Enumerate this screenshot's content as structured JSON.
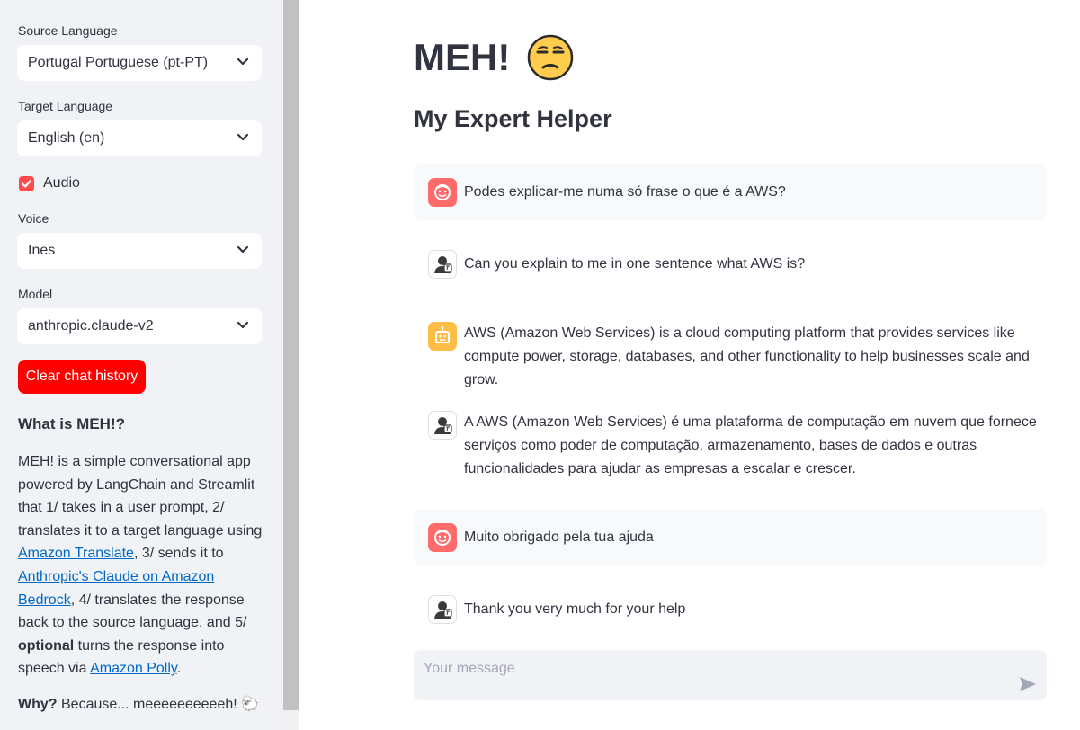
{
  "sidebar": {
    "source_language": {
      "label": "Source Language",
      "value": "Portugal Portuguese (pt-PT)"
    },
    "target_language": {
      "label": "Target Language",
      "value": "English (en)"
    },
    "audio": {
      "label": "Audio",
      "checked": true
    },
    "voice": {
      "label": "Voice",
      "value": "Ines"
    },
    "model": {
      "label": "Model",
      "value": "anthropic.claude-v2"
    },
    "clear_button": "Clear chat history",
    "about": {
      "title": "What is MEH!?",
      "p1": "MEH! is a simple conversational app powered by LangChain and Streamlit that 1/ takes in a user prompt, 2/ translates it to a target language using ",
      "link1": "Amazon Translate",
      "p2": ", 3/ sends it to ",
      "link2": "Anthropic's Claude on Amazon Bedrock",
      "p3": ", 4/ translates the response back to the source language, and 5/ ",
      "bold": "optional",
      "p4": " turns the response into speech via ",
      "link3": "Amazon Polly",
      "p5": "."
    },
    "why": {
      "bold": "Why?",
      "text": " Because... meeeeeeeeeeh! 🐑"
    }
  },
  "main": {
    "title": "MEH!",
    "title_icon": "unamused-face-icon",
    "subtitle": "My Expert Helper",
    "messages": [
      {
        "role": "user",
        "text": "Podes explicar-me numa só frase o que é a AWS?"
      },
      {
        "role": "translation",
        "text": "Can you explain to me in one sentence what AWS is?"
      },
      {
        "role": "assistant",
        "text": "AWS (Amazon Web Services) is a cloud computing platform that provides services like compute power, storage, databases, and other functionality to help businesses scale and grow."
      },
      {
        "role": "translation",
        "text": "A AWS (Amazon Web Services) é uma plataforma de computação em nuvem que fornece serviços como poder de computação, armazenamento, bases de dados e outras funcionalidades para ajudar as empresas a escalar e crescer."
      },
      {
        "role": "user",
        "text": "Muito obrigado pela tua ajuda"
      },
      {
        "role": "translation",
        "text": "Thank you very much for your help"
      }
    ],
    "chat_input": {
      "placeholder": "Your message",
      "value": ""
    }
  },
  "colors": {
    "accent": "#ff4b4b",
    "clear_button": "#ff0000",
    "sidebar_bg": "#f0f2f6",
    "link": "#0068c9",
    "user_avatar": "#ff6b6b",
    "assistant_avatar": "#ffbd45"
  }
}
